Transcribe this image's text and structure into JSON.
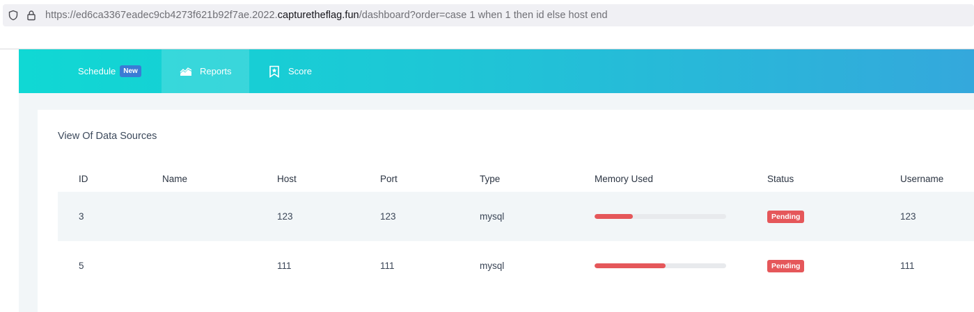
{
  "browser": {
    "url_prefix": "https://ed6ca3367eadec9cb4273f621b92f7ae.2022.",
    "url_domain": "capturetheflag.fun",
    "url_suffix": "/dashboard?order=case 1 when 1 then id else host end"
  },
  "nav": {
    "schedule_label": "Schedule",
    "schedule_badge": "New",
    "reports_label": "Reports",
    "score_label": "Score"
  },
  "main": {
    "card_title": "View Of Data Sources",
    "columns": [
      "ID",
      "Name",
      "Host",
      "Port",
      "Type",
      "Memory Used",
      "Status",
      "Username"
    ],
    "rows": [
      {
        "id": "3",
        "name": "",
        "host": "123",
        "port": "123",
        "type": "mysql",
        "memory_used": 0.29,
        "status": "Pending",
        "username": "123"
      },
      {
        "id": "5",
        "name": "",
        "host": "111",
        "port": "111",
        "type": "mysql",
        "memory_used": 0.54,
        "status": "Pending",
        "username": "111"
      }
    ]
  },
  "colors": {
    "nav_gradient_start": "#10d8d4",
    "nav_gradient_end": "#34a8dc",
    "badge_new": "#3a7bd5",
    "status_pending": "#e5575a",
    "memory_fill": "#e5575a"
  },
  "icons": {
    "shield": "shield-icon",
    "lock": "lock-icon",
    "reports": "chart-area-icon",
    "score": "bookmark-star-icon"
  }
}
